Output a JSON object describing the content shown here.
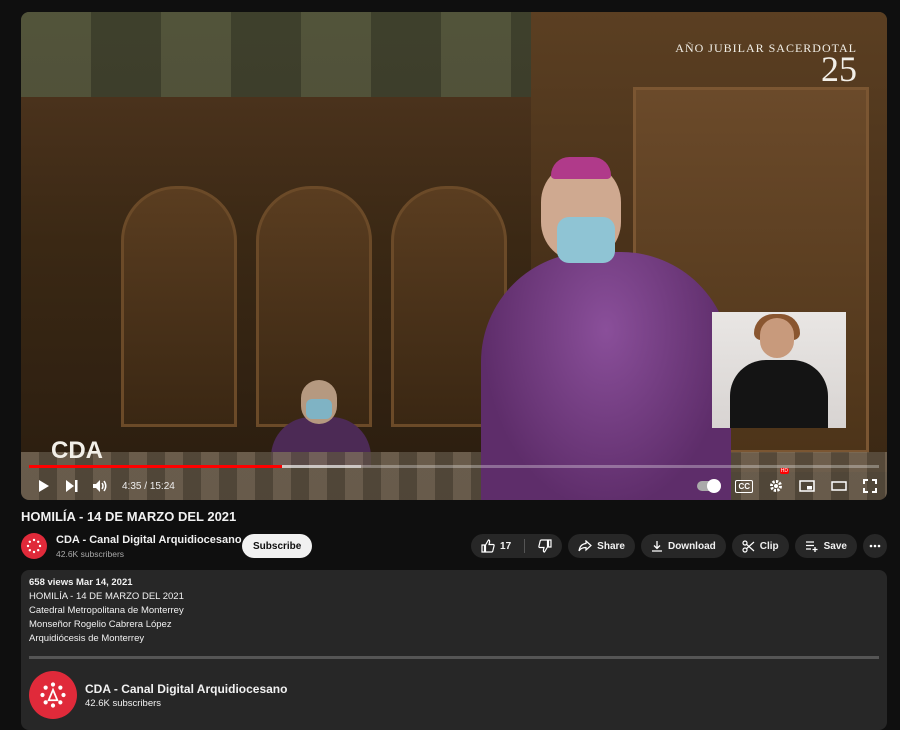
{
  "player": {
    "overlay_logo_top": "AÑO JUBILAR SACERDOTAL",
    "overlay_logo_number": "25",
    "overlay_logo_bottom": "CDA",
    "time_current": "4:35",
    "time_sep": "/",
    "time_total": "15:24",
    "progress_fraction": 0.298,
    "buffered_fraction": 0.39,
    "hd_badge": "HD",
    "cc_label": "CC"
  },
  "video": {
    "title": "HOMILÍA - 14 DE MARZO DEL 2021"
  },
  "channel": {
    "name": "CDA - Canal Digital Arquidiocesano",
    "subscribers": "42.6K subscribers",
    "subscribe_label": "Subscribe"
  },
  "actions": {
    "like_count": "17",
    "share_label": "Share",
    "download_label": "Download",
    "clip_label": "Clip",
    "save_label": "Save"
  },
  "description": {
    "meta": "658 views  Mar 14, 2021",
    "lines": [
      "HOMILÍA - 14 DE MARZO DEL 2021",
      "Catedral Metropolitana de Monterrey",
      "Monseñor Rogelio Cabrera López",
      "Arquidiócesis de Monterrey"
    ],
    "channel_name": "CDA - Canal Digital Arquidiocesano",
    "channel_subscribers": "42.6K subscribers"
  },
  "colors": {
    "progress": "#ff0000",
    "avatar": "#e02a3a",
    "background": "#0f0f0f",
    "panel": "#272727"
  }
}
